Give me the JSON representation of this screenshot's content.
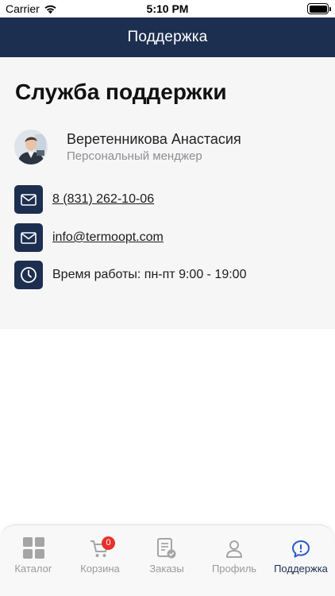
{
  "status_bar": {
    "carrier": "Carrier",
    "time": "5:10 PM"
  },
  "nav": {
    "title": "Поддержка"
  },
  "page": {
    "title": "Служба поддержки"
  },
  "manager": {
    "name": "Веретенникова Анастасия",
    "role": "Персональный менджер"
  },
  "contacts": {
    "phone": "8 (831) 262-10-06",
    "email": "info@termoopt.com",
    "hours": "Время работы: пн-пт 9:00 - 19:00"
  },
  "tabs": [
    {
      "label": "Каталог",
      "icon": "grid-icon"
    },
    {
      "label": "Корзина",
      "icon": "cart-icon",
      "badge": "0"
    },
    {
      "label": "Заказы",
      "icon": "orders-icon"
    },
    {
      "label": "Профиль",
      "icon": "person-icon"
    },
    {
      "label": "Поддержка",
      "icon": "support-chat-icon",
      "active": true
    }
  ],
  "colors": {
    "brand": "#1d2f50",
    "badge": "#e8322d",
    "inactive": "#9a9a9a"
  }
}
